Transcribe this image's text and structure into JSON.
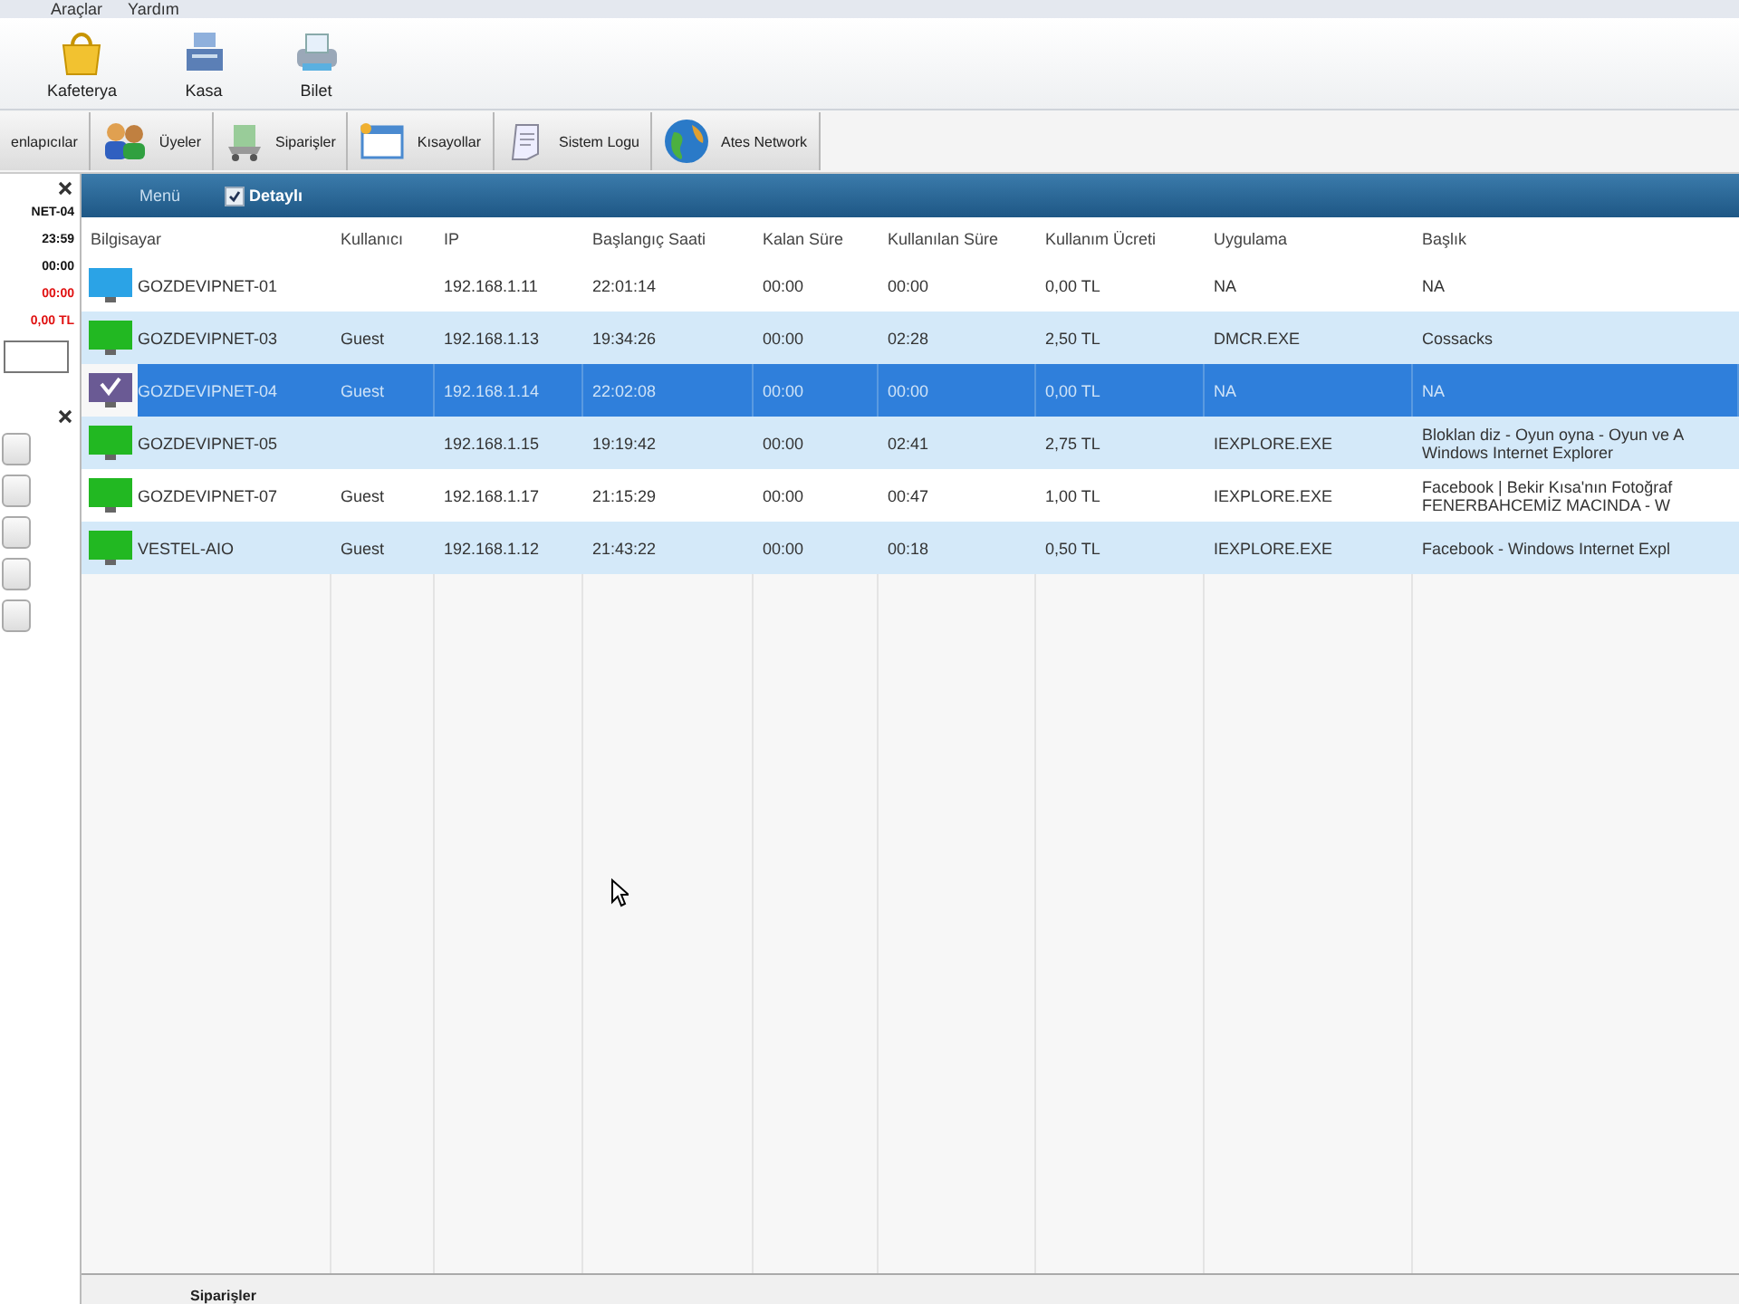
{
  "menu": [
    "Araçlar",
    "Yardım"
  ],
  "toolbar": [
    {
      "label": "Kafeterya",
      "kind": "bag"
    },
    {
      "label": "Kasa",
      "kind": "register"
    },
    {
      "label": "Bilet",
      "kind": "printer"
    }
  ],
  "tabs": [
    {
      "label": "enlapıcılar",
      "kind": "plain"
    },
    {
      "label": "Üyeler",
      "kind": "users"
    },
    {
      "label": "Siparişler",
      "kind": "cart"
    },
    {
      "label": "Kısayollar",
      "kind": "window"
    },
    {
      "label": "Sistem Logu",
      "kind": "log"
    },
    {
      "label": "Ates Network",
      "kind": "globe"
    }
  ],
  "side_panel": {
    "computer": "NET-04",
    "start": "23:59",
    "remaining": "00:00",
    "used": "00:00",
    "fee": "0,00 TL"
  },
  "grid": {
    "menu_label": "Menü",
    "detail": {
      "label": "Detaylı",
      "checked": true
    },
    "columns": [
      "Bilgisayar",
      "Kullanıcı",
      "IP",
      "Başlangıç Saati",
      "Kalan Süre",
      "Kullanılan Süre",
      "Kullanım Ücreti",
      "Uygulama",
      "Başlık"
    ],
    "rows": [
      {
        "name": "GOZDEVIPNET-01",
        "user": "",
        "ip": "192.168.1.11",
        "start": "22:01:14",
        "remaining": "00:00",
        "used": "00:00",
        "fee": "0,00 TL",
        "app": "NA",
        "title": "NA",
        "color": "#2ba3e6",
        "selected": false
      },
      {
        "name": "GOZDEVIPNET-03",
        "user": "Guest",
        "ip": "192.168.1.13",
        "start": "19:34:26",
        "remaining": "00:00",
        "used": "02:28",
        "fee": "2,50 TL",
        "app": "DMCR.EXE",
        "title": "Cossacks",
        "color": "#22b822",
        "selected": false
      },
      {
        "name": "GOZDEVIPNET-04",
        "user": "Guest",
        "ip": "192.168.1.14",
        "start": "22:02:08",
        "remaining": "00:00",
        "used": "00:00",
        "fee": "0,00 TL",
        "app": "NA",
        "title": "NA",
        "color": "#6a5a94",
        "selected": true
      },
      {
        "name": "GOZDEVIPNET-05",
        "user": "",
        "ip": "192.168.1.15",
        "start": "19:19:42",
        "remaining": "00:00",
        "used": "02:41",
        "fee": "2,75 TL",
        "app": "IEXPLORE.EXE",
        "title": "Bloklan diz - Oyun oyna - Oyun ve A\nWindows Internet Explorer",
        "color": "#22b822",
        "selected": false
      },
      {
        "name": "GOZDEVIPNET-07",
        "user": "Guest",
        "ip": "192.168.1.17",
        "start": "21:15:29",
        "remaining": "00:00",
        "used": "00:47",
        "fee": "1,00 TL",
        "app": "IEXPLORE.EXE",
        "title": "Facebook | Bekir Kısa'nın Fotoğraf\nFENERBAHCEMİZ MACINDA - W",
        "color": "#22b822",
        "selected": false
      },
      {
        "name": "VESTEL-AIO",
        "user": "Guest",
        "ip": "192.168.1.12",
        "start": "21:43:22",
        "remaining": "00:00",
        "used": "00:18",
        "fee": "0,50 TL",
        "app": "IEXPLORE.EXE",
        "title": "Facebook - Windows Internet Expl",
        "color": "#22b822",
        "selected": false
      }
    ]
  },
  "bottom_tab": "Siparişler"
}
